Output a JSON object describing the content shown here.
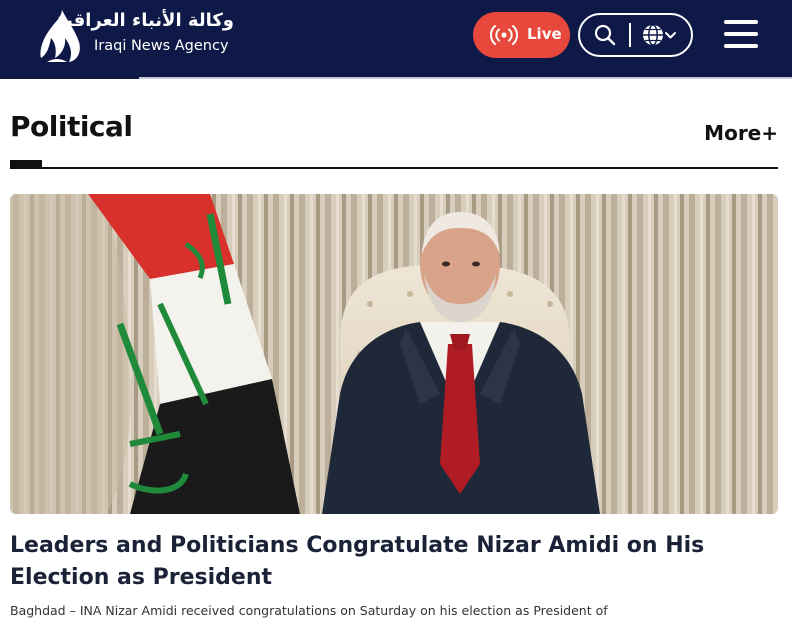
{
  "header": {
    "brand_arabic": "وكالة الأنباء العراقية",
    "brand_english": "Iraqi News Agency",
    "live_label": "Live",
    "icons": {
      "logo": "ina-flame-logo",
      "live": "broadcast-icon",
      "search": "search-icon",
      "language": "globe-icon",
      "menu": "hamburger-menu-icon"
    },
    "colors": {
      "header_bg": "#0f1947",
      "live_bg": "#e8483b"
    }
  },
  "section": {
    "title": "Political",
    "more_label": "More+"
  },
  "article": {
    "title": "Leaders and Politicians Congratulate Nizar Amidi on His Election as President",
    "excerpt": "Baghdad – INA Nizar Amidi received congratulations on Saturday on his election as President of"
  }
}
